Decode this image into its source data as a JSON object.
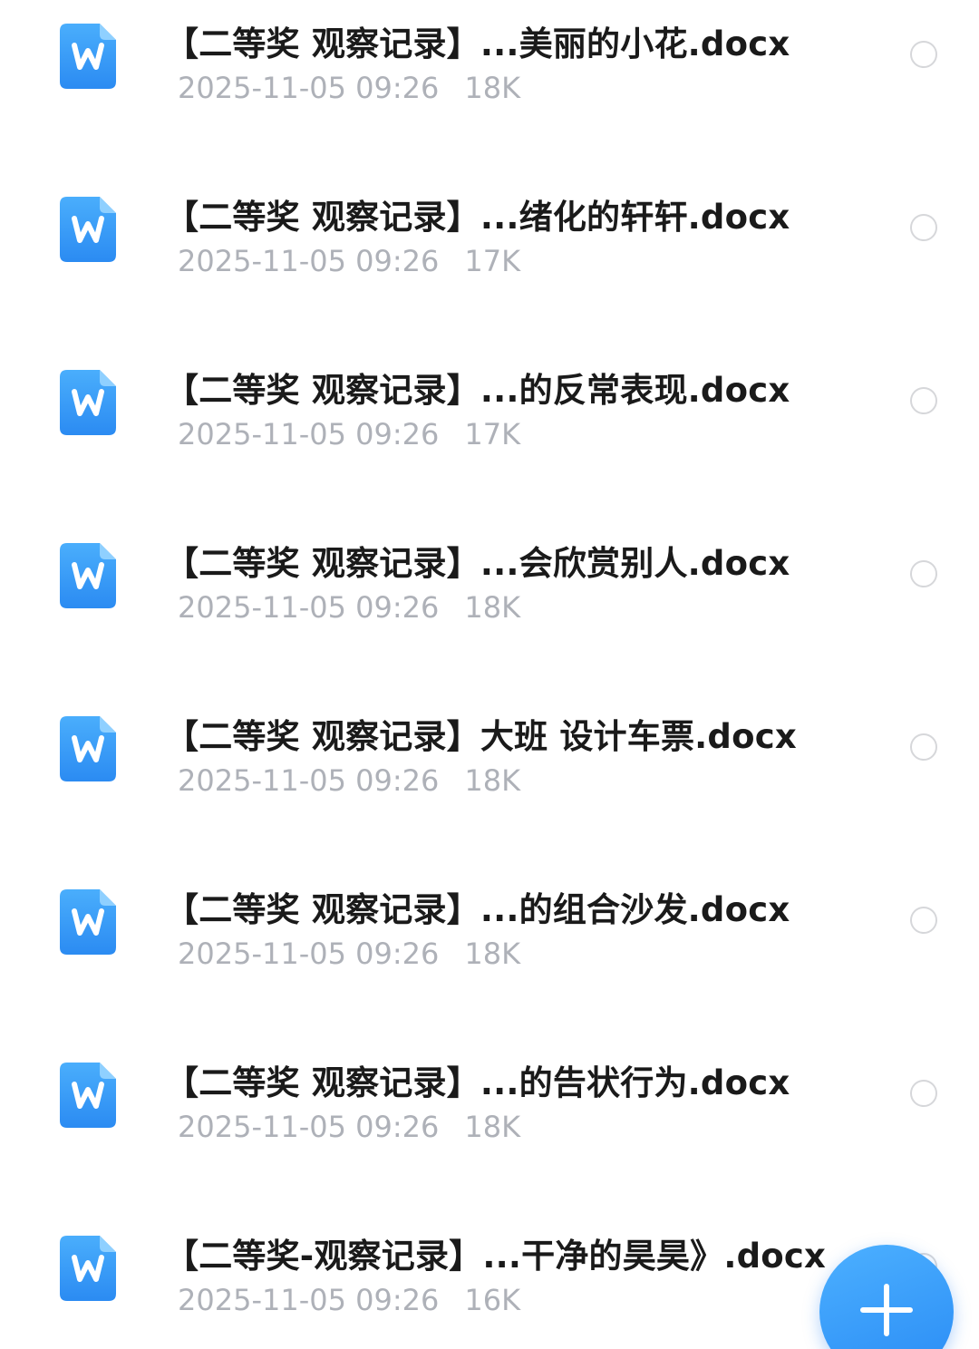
{
  "files": [
    {
      "name": "【二等奖 观察记录】...美丽的小花.docx",
      "date": "2025-11-05 09:26",
      "size": "18K"
    },
    {
      "name": "【二等奖 观察记录】...绪化的轩轩.docx",
      "date": "2025-11-05 09:26",
      "size": "17K"
    },
    {
      "name": "【二等奖 观察记录】...的反常表现.docx",
      "date": "2025-11-05 09:26",
      "size": "17K"
    },
    {
      "name": "【二等奖 观察记录】...会欣赏别人.docx",
      "date": "2025-11-05 09:26",
      "size": "18K"
    },
    {
      "name": "【二等奖 观察记录】大班 设计车票.docx",
      "date": "2025-11-05 09:26",
      "size": "18K"
    },
    {
      "name": "【二等奖 观察记录】...的组合沙发.docx",
      "date": "2025-11-05 09:26",
      "size": "18K"
    },
    {
      "name": "【二等奖 观察记录】...的告状行为.docx",
      "date": "2025-11-05 09:26",
      "size": "18K"
    },
    {
      "name": "【二等奖-观察记录】...干净的昊昊》.docx",
      "date": "2025-11-05 09:26",
      "size": "16K"
    }
  ],
  "icons": {
    "file_icon": "word-doc-icon",
    "fab_icon": "plus-icon"
  },
  "colors": {
    "doc_icon_top": "#4aaefc",
    "doc_icon_bottom": "#2b8bf2",
    "fab": "#2a8cf5",
    "meta_text": "#aeb1b8"
  }
}
